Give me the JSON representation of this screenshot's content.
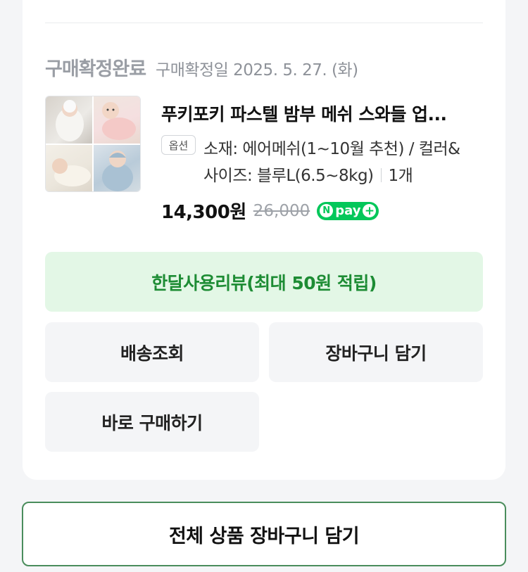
{
  "order": {
    "status_title": "구매확정완료",
    "status_date": "구매확정일 2025. 5. 27. (화)"
  },
  "product": {
    "title": "푸키포키 파스텔 밤부 메쉬 스와들 업...",
    "option_badge": "옵션",
    "option_line1": "소재: 에어메쉬(1~10월 추천) / 컬러&",
    "option_line2": "사이즈: 블루L(6.5~8kg)",
    "quantity": "1개",
    "price": "14,300원",
    "original_price": "26,000",
    "npay": {
      "n": "N",
      "label": "pay",
      "plus": "+"
    }
  },
  "buttons": {
    "review": "한달사용리뷰(최대 50원 적립)",
    "shipping": "배송조회",
    "add_cart": "장바구니 담기",
    "buy_now": "바로 구매하기",
    "add_all_cart": "전체 상품 장바구니 담기"
  },
  "colors": {
    "review_bg": "#e3f7e6",
    "review_text": "#1d8c34",
    "npay_green": "#03c75a",
    "outline_green": "#4a8d5c"
  }
}
